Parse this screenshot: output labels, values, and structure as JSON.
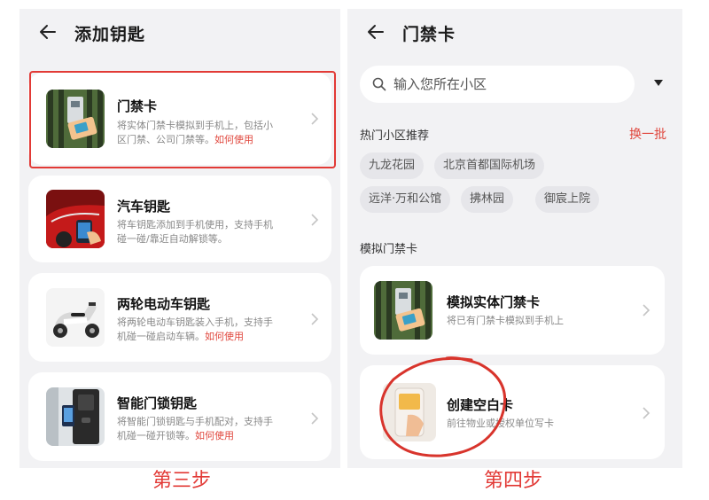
{
  "left": {
    "header": {
      "title": "添加钥匙"
    },
    "cards": [
      {
        "title": "门禁卡",
        "desc_line1": "将实体门禁卡模拟到手机上，包括小",
        "desc_line2": "区门禁、公司门禁等。",
        "link": "如何使用"
      },
      {
        "title": "汽车钥匙",
        "desc_line1": "将车钥匙添加到手机使用，支持手机",
        "desc_line2": "碰一碰/靠近自动解锁等。",
        "link": ""
      },
      {
        "title": "两轮电动车钥匙",
        "desc_line1": "将两轮电动车钥匙装入手机，支持手",
        "desc_line2": "机碰一碰启动车辆。",
        "link": "如何使用"
      },
      {
        "title": "智能门锁钥匙",
        "desc_line1": "将智能门锁钥匙与手机配对，支持手",
        "desc_line2": "机碰一碰开锁等。",
        "link": "如何使用"
      }
    ],
    "step_label": "第三步"
  },
  "right": {
    "header": {
      "title": "门禁卡"
    },
    "search": {
      "placeholder": "输入您所在小区",
      "value": ""
    },
    "hot": {
      "title": "热门小区推荐",
      "refresh": "换一批",
      "chips": [
        "九龙花园",
        "北京首都国际机场",
        "远洋·万和公馆",
        "拂林园",
        "御宸上院"
      ]
    },
    "sim": {
      "title": "模拟门禁卡",
      "cards": [
        {
          "title": "模拟实体门禁卡",
          "desc": "将已有门禁卡模拟到手机上"
        },
        {
          "title": "创建空白卡",
          "desc": "前往物业或授权单位写卡"
        }
      ]
    },
    "step_label": "第四步"
  },
  "colors": {
    "accent_red": "#e23a36",
    "link_red": "#e0463c",
    "panel_bg": "#f2f2f4",
    "card_bg": "#ffffff"
  },
  "icons": [
    "back-arrow-icon",
    "search-icon",
    "dropdown-triangle-icon",
    "chevron-right-icon"
  ]
}
